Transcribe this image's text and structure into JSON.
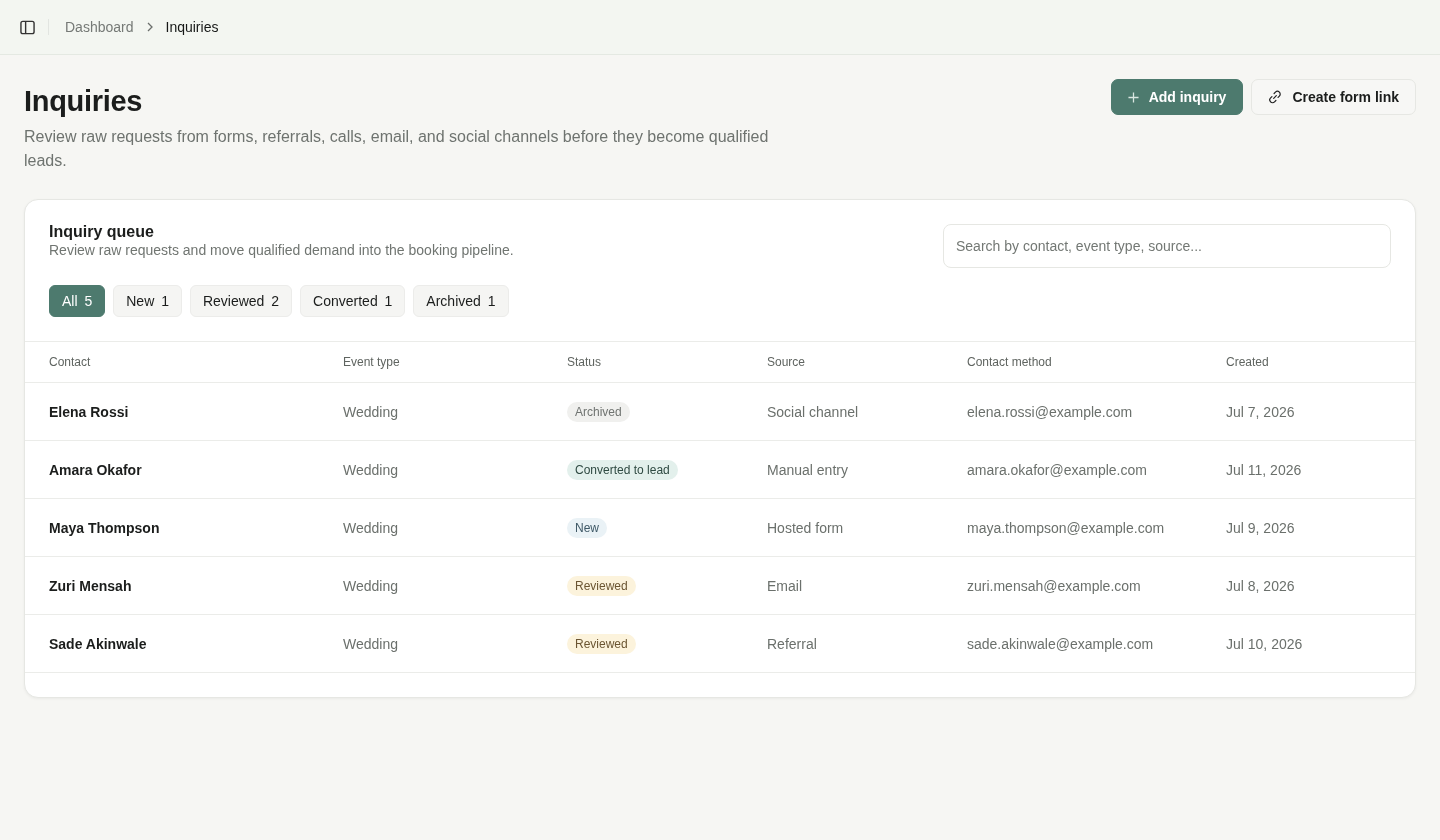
{
  "top_bar": {
    "breadcrumbs": [
      {
        "label": "Dashboard",
        "current": false
      },
      {
        "label": "Inquiries",
        "current": true
      }
    ]
  },
  "header": {
    "title": "Inquiries",
    "subtitle": "Review raw requests from forms, referrals, calls, email, and social channels before they become qualified leads.",
    "actions": [
      {
        "label": "Add inquiry",
        "kind": "primary"
      },
      {
        "label": "Create form link",
        "kind": "secondary"
      }
    ]
  },
  "queue": {
    "title": "Inquiry queue",
    "description": "Review raw requests and move qualified demand into the booking pipeline.",
    "search": {
      "placeholder": "Search by contact, event type, source..."
    },
    "tabs": [
      {
        "label": "All",
        "count": "5",
        "selected": true
      },
      {
        "label": "New",
        "count": "1",
        "selected": false
      },
      {
        "label": "Reviewed",
        "count": "2",
        "selected": false
      },
      {
        "label": "Converted",
        "count": "1",
        "selected": false
      },
      {
        "label": "Archived",
        "count": "1",
        "selected": false
      }
    ],
    "table": {
      "columns": [
        "Contact",
        "Event type",
        "Status",
        "Source",
        "Contact method",
        "Created"
      ],
      "rows": [
        {
          "contact": "Elena Rossi",
          "event_type": "Wedding",
          "status": {
            "label": "Archived",
            "kind": "archived"
          },
          "source": "Social channel",
          "contact_method": "elena.rossi@example.com",
          "created": "Jul 7, 2026"
        },
        {
          "contact": "Amara Okafor",
          "event_type": "Wedding",
          "status": {
            "label": "Converted to lead",
            "kind": "converted"
          },
          "source": "Manual entry",
          "contact_method": "amara.okafor@example.com",
          "created": "Jul 11, 2026"
        },
        {
          "contact": "Maya Thompson",
          "event_type": "Wedding",
          "status": {
            "label": "New",
            "kind": "new"
          },
          "source": "Hosted form",
          "contact_method": "maya.thompson@example.com",
          "created": "Jul 9, 2026"
        },
        {
          "contact": "Zuri Mensah",
          "event_type": "Wedding",
          "status": {
            "label": "Reviewed",
            "kind": "reviewed"
          },
          "source": "Email",
          "contact_method": "zuri.mensah@example.com",
          "created": "Jul 8, 2026"
        },
        {
          "contact": "Sade Akinwale",
          "event_type": "Wedding",
          "status": {
            "label": "Reviewed",
            "kind": "reviewed"
          },
          "source": "Referral",
          "contact_method": "sade.akinwale@example.com",
          "created": "Jul 10, 2026"
        }
      ]
    }
  }
}
